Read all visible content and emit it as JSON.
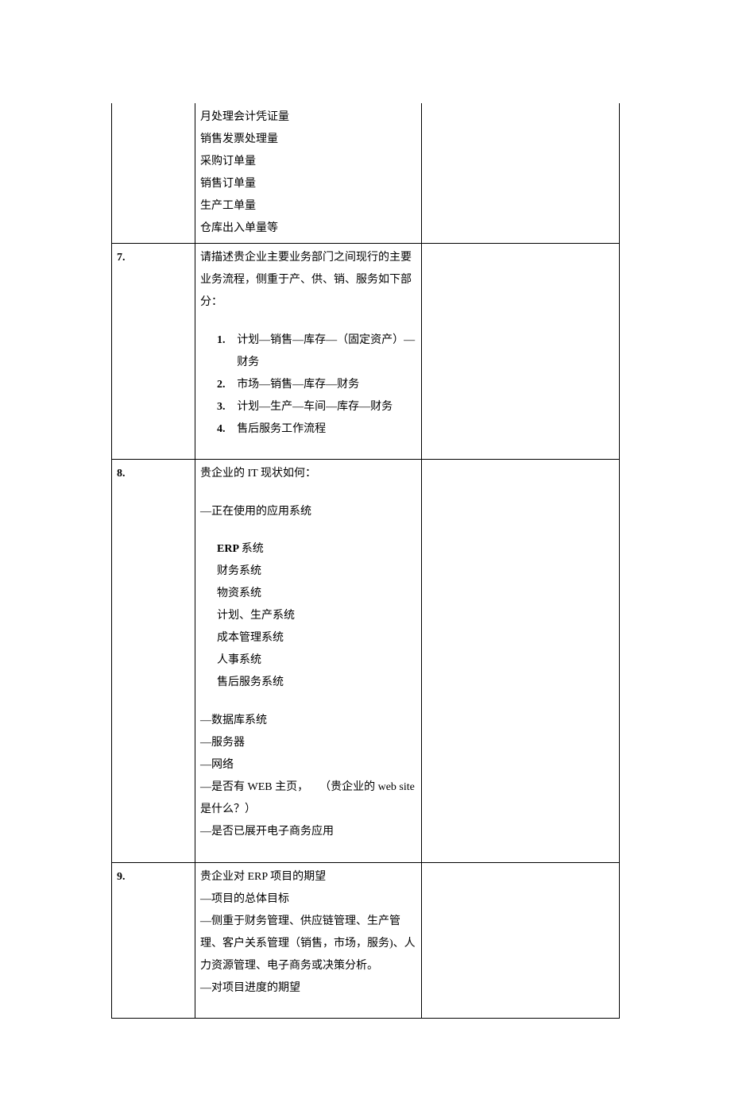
{
  "rows": [
    {
      "num": "",
      "lines": [
        {
          "text": "月处理会计凭证量",
          "cls": ""
        },
        {
          "text": "销售发票处理量",
          "cls": ""
        },
        {
          "text": "采购订单量",
          "cls": ""
        },
        {
          "text": "销售订单量",
          "cls": ""
        },
        {
          "text": "生产工单量",
          "cls": ""
        },
        {
          "text": "仓库出入单量等",
          "cls": ""
        }
      ]
    },
    {
      "num": "7.",
      "lines": [
        {
          "text": "请描述贵企业主要业务部门之间现行的主要业务流程，侧重于产、供、销、服务如下部分：",
          "cls": ""
        },
        {
          "text": "",
          "cls": "spacer"
        },
        {
          "num": "1.",
          "text": "计划—销售—库存—（固定资产）—财务",
          "cls": "numbered"
        },
        {
          "num": "2.",
          "text": "市场—销售—库存—财务",
          "cls": "numbered"
        },
        {
          "num": "3.",
          "text": "计划—生产—车间—库存—财务",
          "cls": "numbered"
        },
        {
          "num": "4.",
          "text": "售后服务工作流程",
          "cls": "numbered"
        },
        {
          "text": "",
          "cls": "spacer"
        }
      ]
    },
    {
      "num": "8.",
      "lines": [
        {
          "text": "贵企业的 IT 现状如何：",
          "cls": ""
        },
        {
          "text": "",
          "cls": "spacer"
        },
        {
          "text": "—正在使用的应用系统",
          "cls": ""
        },
        {
          "text": "",
          "cls": "spacer"
        },
        {
          "text": "ERP 系统",
          "cls": "indent1 bold-partial",
          "bold_prefix": "ERP"
        },
        {
          "text": "财务系统",
          "cls": "indent1"
        },
        {
          "text": "物资系统",
          "cls": "indent1"
        },
        {
          "text": "计划、生产系统",
          "cls": "indent1"
        },
        {
          "text": "成本管理系统",
          "cls": "indent1"
        },
        {
          "text": "人事系统",
          "cls": "indent1"
        },
        {
          "text": "售后服务系统",
          "cls": "indent1"
        },
        {
          "text": "",
          "cls": "spacer"
        },
        {
          "text": "—数据库系统",
          "cls": ""
        },
        {
          "text": "—服务器",
          "cls": ""
        },
        {
          "text": "—网络",
          "cls": ""
        },
        {
          "text": "—是否有 WEB 主页，　　（贵企业的 web site 是什么？）",
          "cls": ""
        },
        {
          "text": "—是否已展开电子商务应用",
          "cls": ""
        },
        {
          "text": "",
          "cls": "spacer"
        }
      ]
    },
    {
      "num": "9.",
      "lines": [
        {
          "text": "贵企业对 ERP 项目的期望",
          "cls": ""
        },
        {
          "text": "—项目的总体目标",
          "cls": ""
        },
        {
          "text": "—侧重于财务管理、供应链管理、生产管理、客户关系管理（销售，市场，服务)、人力资源管理、电子商务或决策分析。",
          "cls": ""
        },
        {
          "text": "—对项目进度的期望",
          "cls": ""
        },
        {
          "text": "",
          "cls": "spacer"
        }
      ]
    }
  ]
}
